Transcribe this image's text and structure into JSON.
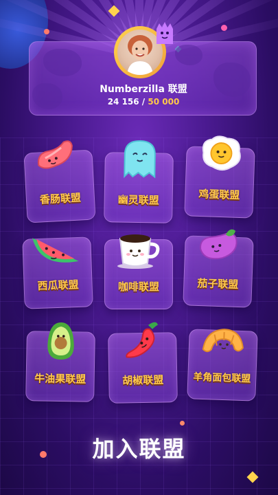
{
  "header": {
    "league_name": "Numberzilla 联盟",
    "score_current": "24 156",
    "score_separator": " / ",
    "score_target": "50 000"
  },
  "leagues": [
    {
      "label": "香肠联盟",
      "icon": "sausage-icon"
    },
    {
      "label": "幽灵联盟",
      "icon": "ghost-icon"
    },
    {
      "label": "鸡蛋联盟",
      "icon": "egg-icon"
    },
    {
      "label": "西瓜联盟",
      "icon": "watermelon-icon"
    },
    {
      "label": "咖啡联盟",
      "icon": "coffee-icon"
    },
    {
      "label": "茄子联盟",
      "icon": "eggplant-icon"
    },
    {
      "label": "牛油果联盟",
      "icon": "avocado-icon"
    },
    {
      "label": "胡椒联盟",
      "icon": "pepper-icon"
    },
    {
      "label": "羊角面包联盟",
      "icon": "croissant-icon"
    }
  ],
  "cta": {
    "label": "加入联盟"
  },
  "colors": {
    "accent_gold": "#ffc94a",
    "background": "#2a0d5c",
    "tile": "#8a4ad0"
  }
}
